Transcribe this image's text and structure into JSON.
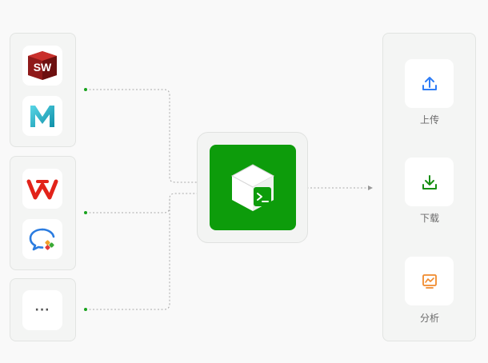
{
  "sources": {
    "group1": [
      {
        "icon": "solidworks-app-icon",
        "text": "SW"
      },
      {
        "icon": "maya-app-icon",
        "text": "M"
      }
    ],
    "group2": [
      {
        "icon": "wps-office-app-icon"
      },
      {
        "icon": "chat-app-icon"
      }
    ],
    "group3": [
      {
        "icon": "more-icon",
        "text": "···"
      }
    ]
  },
  "hub": {
    "icon": "terminal-box-icon",
    "color": "#0d9c0b"
  },
  "actions": [
    {
      "label": "上传",
      "icon": "upload-icon",
      "color": "#2f7df6"
    },
    {
      "label": "下载",
      "icon": "download-icon",
      "color": "#178f13"
    },
    {
      "label": "分析",
      "icon": "monitor-chart-icon",
      "color": "#f08a2c"
    }
  ],
  "colors": {
    "connector": "#a9a9a9",
    "dot": "#19a31e"
  }
}
